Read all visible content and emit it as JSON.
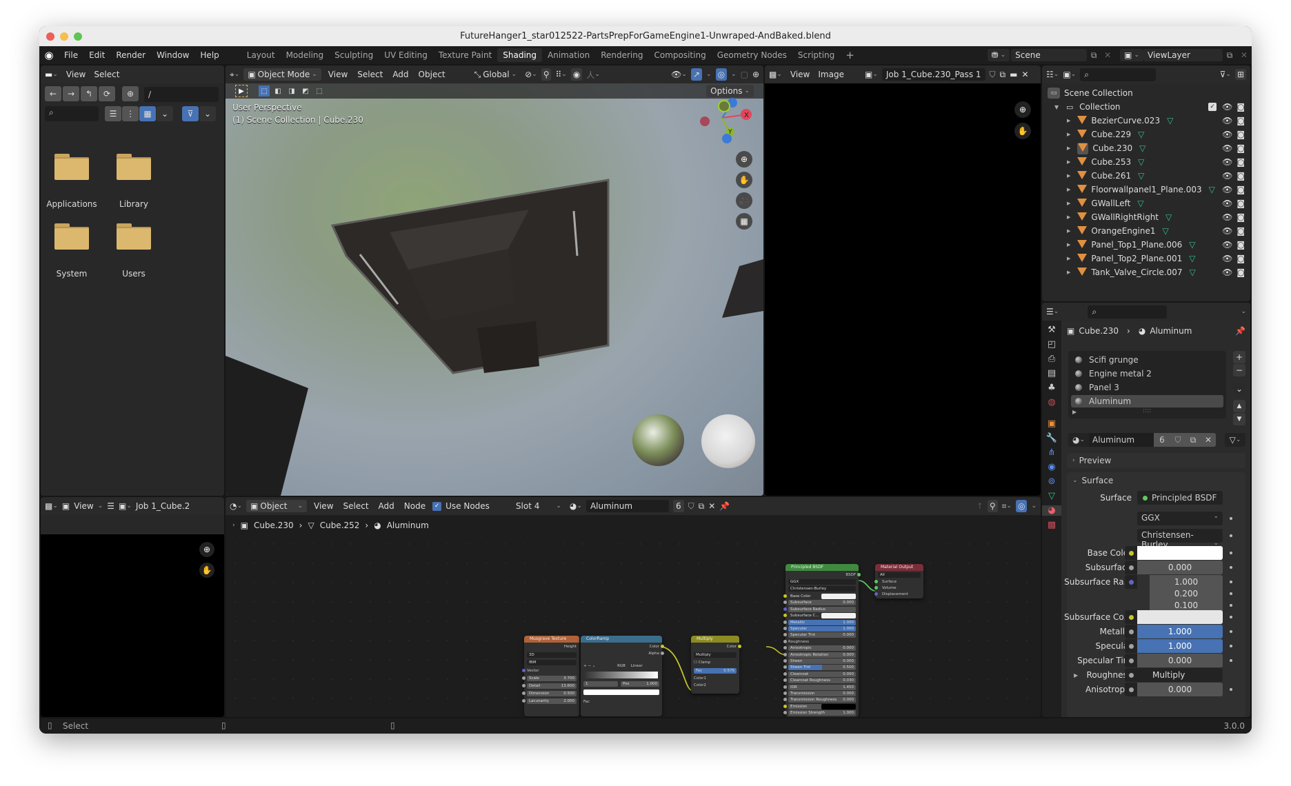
{
  "window": {
    "title": "FutureHanger1_star012522-PartsPrepForGameEngine1-Unwraped-AndBaked.blend"
  },
  "topbar": {
    "menus": [
      "File",
      "Edit",
      "Render",
      "Window",
      "Help"
    ],
    "workspaces": [
      "Layout",
      "Modeling",
      "Sculpting",
      "UV Editing",
      "Texture Paint",
      "Shading",
      "Animation",
      "Rendering",
      "Compositing",
      "Geometry Nodes",
      "Scripting"
    ],
    "active_workspace": "Shading",
    "add_tab": "+",
    "scene": "Scene",
    "view_layer": "ViewLayer"
  },
  "file_browser": {
    "menus": [
      "View",
      "Select"
    ],
    "path": "/",
    "search_placeholder": "",
    "folders": [
      "Applications",
      "Library",
      "System",
      "Users"
    ],
    "folder_color": "#dcb86f"
  },
  "viewport": {
    "mode": "Object Mode",
    "menus": [
      "View",
      "Select",
      "Add",
      "Object"
    ],
    "orientation": "Global",
    "options_label": "Options",
    "overlay_line1": "User Perspective",
    "overlay_line2": "(1) Scene Collection | Cube.230",
    "gizmo_axes": [
      "X",
      "Y",
      "Z"
    ]
  },
  "image_editor": {
    "menus": [
      "View",
      "Image"
    ],
    "image_name": "Job 1_Cube.230_Pass 1"
  },
  "outliner": {
    "scene_collection": "Scene Collection",
    "collection": "Collection",
    "objects": [
      {
        "name": "BezierCurve.023",
        "selected": false
      },
      {
        "name": "Cube.229",
        "selected": false
      },
      {
        "name": "Cube.230",
        "selected": true
      },
      {
        "name": "Cube.253",
        "selected": false
      },
      {
        "name": "Cube.261",
        "selected": false
      },
      {
        "name": "Floorwallpanel1_Plane.003",
        "selected": false
      },
      {
        "name": "GWallLeft",
        "selected": false
      },
      {
        "name": "GWallRightRight",
        "selected": false
      },
      {
        "name": "OrangeEngine1",
        "selected": false
      },
      {
        "name": "Panel_Top1_Plane.006",
        "selected": false
      },
      {
        "name": "Panel_Top2_Plane.001",
        "selected": false
      },
      {
        "name": "Tank_Valve_Circle.007",
        "selected": false
      }
    ]
  },
  "properties": {
    "breadcrumb_object": "Cube.230",
    "breadcrumb_material": "Aluminum",
    "material_slots": [
      "Scifi grunge",
      "Engine metal 2",
      "Panel 3",
      "Aluminum"
    ],
    "active_slot": "Aluminum",
    "material_name": "Aluminum",
    "user_count": "6",
    "panels": {
      "preview": "Preview",
      "surface": "Surface"
    },
    "surface_label": "Surface",
    "surface_shader": "Principled BSDF",
    "distribution": "GGX",
    "subsurface_method": "Christensen-Burley",
    "rows": [
      {
        "label": "Base Color",
        "value": "",
        "kind": "color",
        "color": "#ffffff",
        "socket": "#c7c729"
      },
      {
        "label": "Subsurface",
        "value": "0.000",
        "kind": "num",
        "socket": "#a1a1a1"
      },
      {
        "label": "Subsurface Ra...",
        "value": "1.000",
        "kind": "num",
        "socket": "#6363c7"
      },
      {
        "label": "",
        "value": "0.200",
        "kind": "num",
        "socket": ""
      },
      {
        "label": "",
        "value": "0.100",
        "kind": "num",
        "socket": ""
      },
      {
        "label": "Subsurface Co...",
        "value": "",
        "kind": "color",
        "color": "#e6e6e6",
        "socket": "#c7c729"
      },
      {
        "label": "Metallic",
        "value": "1.000",
        "kind": "blue",
        "socket": "#a1a1a1"
      },
      {
        "label": "Specular",
        "value": "1.000",
        "kind": "blue",
        "socket": "#a1a1a1"
      },
      {
        "label": "Specular Tint",
        "value": "0.000",
        "kind": "num",
        "socket": "#a1a1a1"
      },
      {
        "label": "Roughness",
        "value": "Multiply",
        "kind": "link",
        "socket": "#a1a1a1"
      },
      {
        "label": "Anisotropic",
        "value": "0.000",
        "kind": "num",
        "socket": "#a1a1a1"
      }
    ]
  },
  "node_editor": {
    "object_menu": "Object",
    "menus": [
      "View",
      "Select",
      "Add",
      "Node"
    ],
    "use_nodes_label": "Use Nodes",
    "use_nodes": true,
    "slot": "Slot 4",
    "material": "Aluminum",
    "user_count": "6",
    "breadcrumb": [
      "Cube.230",
      "Cube.252",
      "Aluminum"
    ],
    "nodes": {
      "musgrave": {
        "title": "Musgrave Texture",
        "output": "Height",
        "dim": "3D",
        "type": "fBM",
        "input": "Vector",
        "fields": [
          {
            "k": "Scale",
            "v": "3.700"
          },
          {
            "k": "Detail",
            "v": "13.600"
          },
          {
            "k": "Dimension",
            "v": "0.500"
          },
          {
            "k": "Lacunarity",
            "v": "2.000"
          }
        ]
      },
      "colorramp": {
        "title": "ColorRamp",
        "outputs": [
          "Color",
          "Alpha"
        ],
        "mode": "RGB",
        "interp": "Linear",
        "index": "1",
        "pos_label": "Pos",
        "pos": "1.000",
        "input": "Fac"
      },
      "multiply": {
        "title": "Multiply",
        "output": "Color",
        "blend": "Multiply",
        "clamp": "Clamp",
        "fac_label": "Fac",
        "fac": "0.575",
        "inputs": [
          "Color1",
          "Color2"
        ]
      },
      "bsdf": {
        "title": "Principled BSDF",
        "output": "BSDF",
        "dist": "GGX",
        "sss": "Christensen-Burley",
        "rows": [
          {
            "k": "Base Color",
            "v": "",
            "t": "color"
          },
          {
            "k": "Subsurface",
            "v": "0.000",
            "t": "num"
          },
          {
            "k": "Subsurface Radius",
            "v": "",
            "t": "dd"
          },
          {
            "k": "Subsurface C...",
            "v": "",
            "t": "color"
          },
          {
            "k": "Metallic",
            "v": "1.000",
            "t": "blue"
          },
          {
            "k": "Specular",
            "v": "1.000",
            "t": "blue"
          },
          {
            "k": "Specular Tint",
            "v": "0.000",
            "t": "num"
          },
          {
            "k": "Roughness",
            "v": "",
            "t": "label"
          },
          {
            "k": "Anisotropic",
            "v": "0.000",
            "t": "num"
          },
          {
            "k": "Anisotropic Rotation",
            "v": "0.000",
            "t": "num"
          },
          {
            "k": "Sheen",
            "v": "0.000",
            "t": "num"
          },
          {
            "k": "Sheen Tint",
            "v": "0.500",
            "t": "half"
          },
          {
            "k": "Clearcoat",
            "v": "0.000",
            "t": "num"
          },
          {
            "k": "Clearcoat Roughness",
            "v": "0.030",
            "t": "num"
          },
          {
            "k": "IOR",
            "v": "1.450",
            "t": "num"
          },
          {
            "k": "Transmission",
            "v": "0.000",
            "t": "num"
          },
          {
            "k": "Transmission Roughness",
            "v": "0.000",
            "t": "num"
          },
          {
            "k": "Emission",
            "v": "",
            "t": "black"
          },
          {
            "k": "Emission Strength",
            "v": "1.000",
            "t": "num"
          }
        ]
      },
      "output": {
        "title": "Material Output",
        "target": "All",
        "inputs": [
          "Surface",
          "Volume",
          "Displacement"
        ]
      }
    }
  },
  "left_image_editor": {
    "menu": "View",
    "image_name": "Job 1_Cube.2"
  },
  "statusbar": {
    "hint": "Select",
    "version": "3.0.0"
  }
}
